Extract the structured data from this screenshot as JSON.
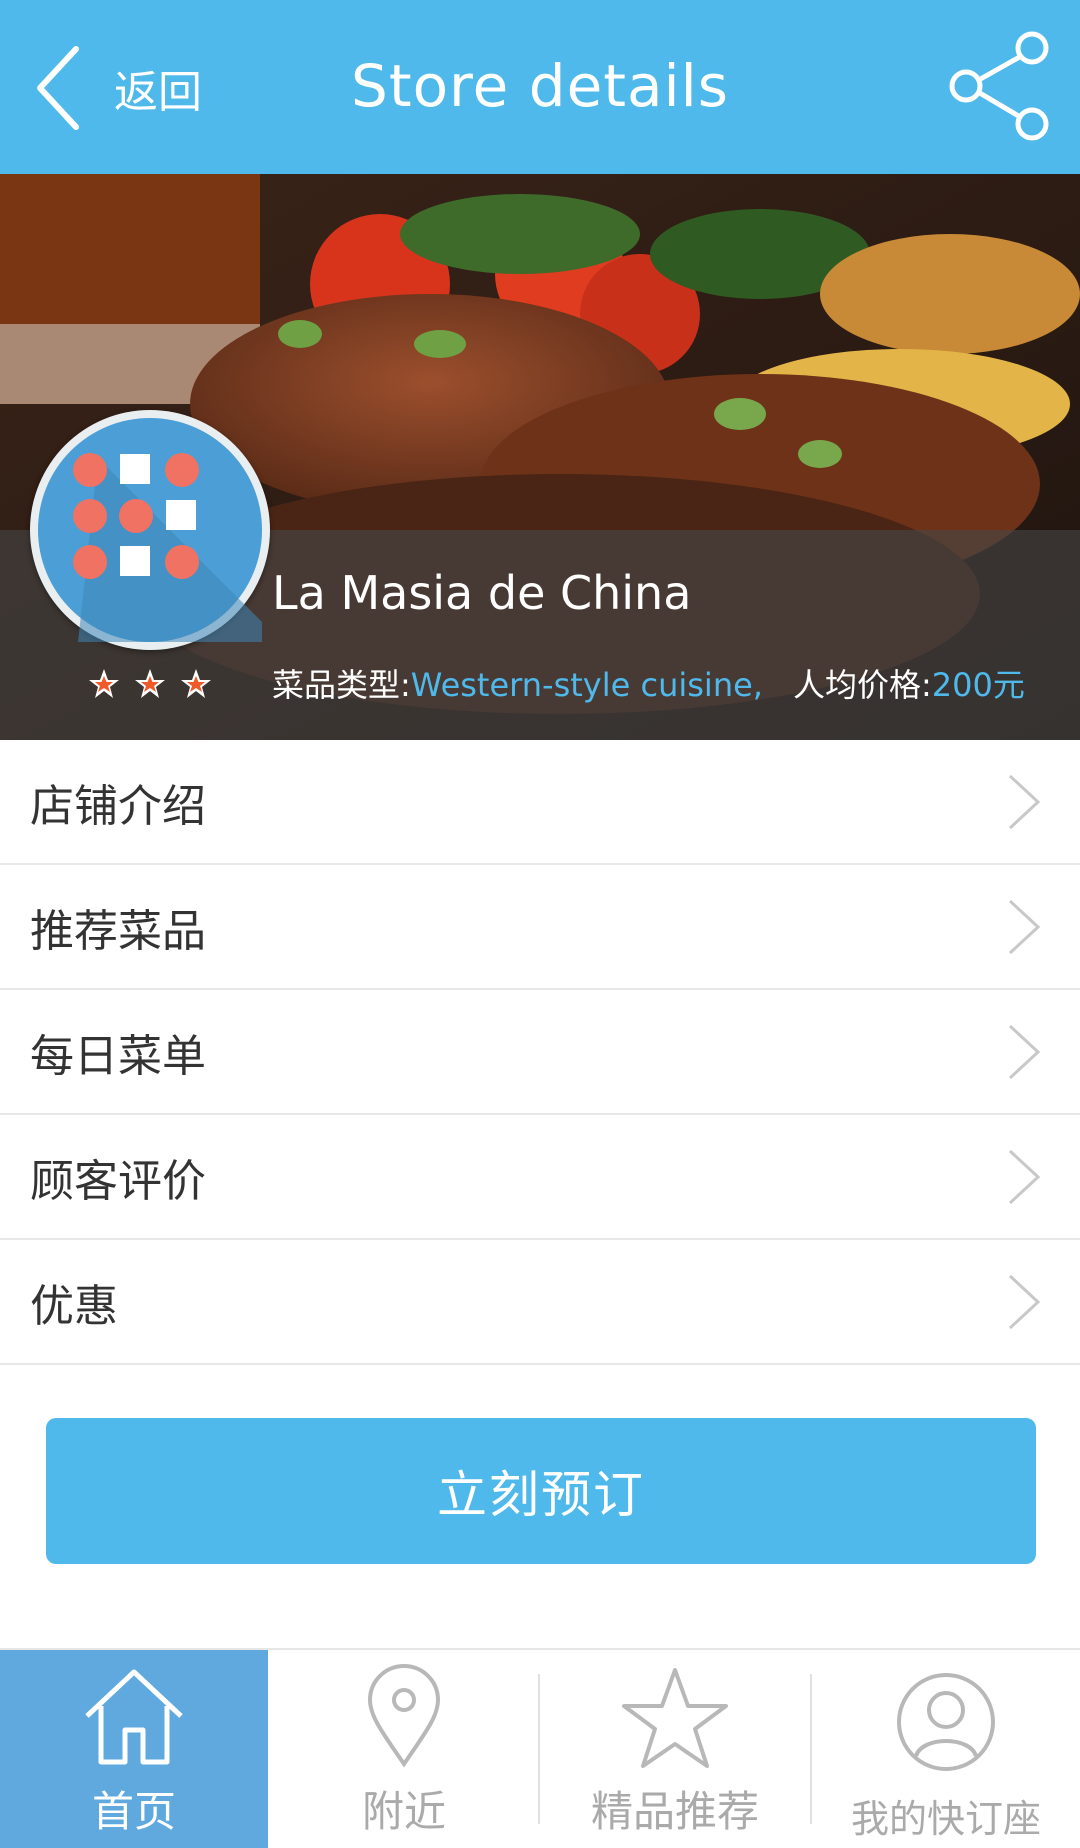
{
  "header": {
    "back_label": "返回",
    "title": "Store details"
  },
  "store": {
    "name": "La Masia de China",
    "rating": 3,
    "cuisine_label": "菜品类型:",
    "cuisine_value": "Western-style cuisine,",
    "price_label": "人均价格:",
    "price_value": "200元"
  },
  "menu": {
    "items": [
      {
        "label": "店铺介绍"
      },
      {
        "label": "推荐菜品"
      },
      {
        "label": "每日菜单"
      },
      {
        "label": "顾客评价"
      },
      {
        "label": "优惠"
      }
    ]
  },
  "reserve_button": "立刻预订",
  "bottom_nav": {
    "items": [
      {
        "label": "首页",
        "icon": "home-icon",
        "active": true
      },
      {
        "label": "附近",
        "icon": "location-pin-icon",
        "active": false
      },
      {
        "label": "精品推荐",
        "icon": "star-icon",
        "active": false
      },
      {
        "label": "我的快订座",
        "icon": "user-icon",
        "active": false
      }
    ]
  },
  "colors": {
    "accent": "#4eb9ea",
    "nav_active": "#5fa9df",
    "star_fill": "#f05a28"
  }
}
